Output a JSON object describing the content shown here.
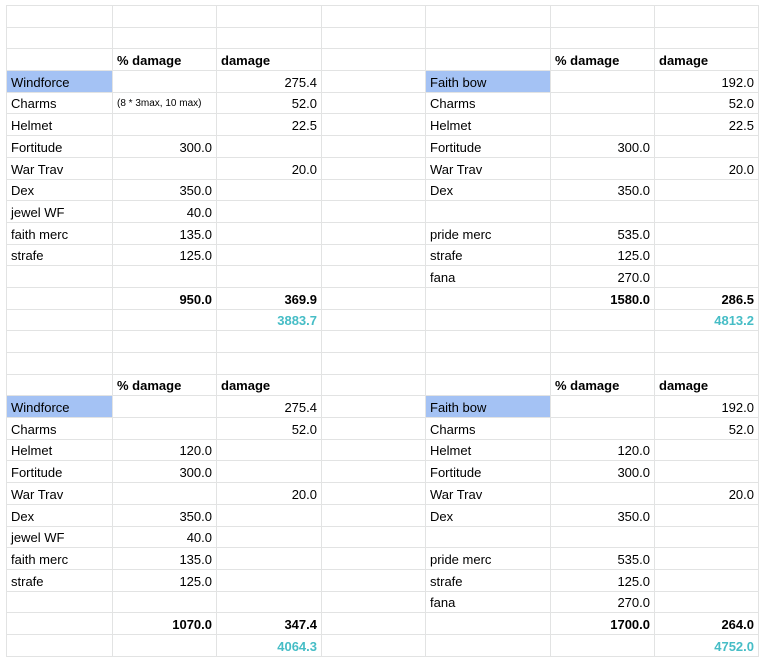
{
  "colors": {
    "highlight": "#a4c2f4",
    "total_text": "#46bdc6",
    "grid": "#e2e3e3"
  },
  "headers": {
    "pct": "% damage",
    "dmg": "damage"
  },
  "blocks": [
    {
      "rows": [
        {
          "label": "Windforce",
          "pct": "",
          "dmg": "275.4",
          "highlight": true
        },
        {
          "label": "Charms",
          "pct": "(8 * 3max, 10 max)",
          "dmg": "52.0",
          "note": true
        },
        {
          "label": "Helmet",
          "pct": "",
          "dmg": "22.5"
        },
        {
          "label": "Fortitude",
          "pct": "300.0",
          "dmg": ""
        },
        {
          "label": "War Trav",
          "pct": "",
          "dmg": "20.0"
        },
        {
          "label": "Dex",
          "pct": "350.0",
          "dmg": ""
        },
        {
          "label": "jewel WF",
          "pct": "40.0",
          "dmg": ""
        },
        {
          "label": "faith merc",
          "pct": "135.0",
          "dmg": ""
        },
        {
          "label": "strafe",
          "pct": "125.0",
          "dmg": ""
        },
        {
          "label": "",
          "pct": "",
          "dmg": ""
        }
      ],
      "sum_pct": "950.0",
      "sum_dmg": "369.9",
      "total": "3883.7"
    },
    {
      "rows": [
        {
          "label": "Faith bow",
          "pct": "",
          "dmg": "192.0",
          "highlight": true
        },
        {
          "label": "Charms",
          "pct": "",
          "dmg": "52.0"
        },
        {
          "label": "Helmet",
          "pct": "",
          "dmg": "22.5"
        },
        {
          "label": "Fortitude",
          "pct": "300.0",
          "dmg": ""
        },
        {
          "label": "War Trav",
          "pct": "",
          "dmg": "20.0"
        },
        {
          "label": "Dex",
          "pct": "350.0",
          "dmg": ""
        },
        {
          "label": "",
          "pct": "",
          "dmg": ""
        },
        {
          "label": "pride merc",
          "pct": "535.0",
          "dmg": ""
        },
        {
          "label": "strafe",
          "pct": "125.0",
          "dmg": ""
        },
        {
          "label": "fana",
          "pct": "270.0",
          "dmg": ""
        }
      ],
      "sum_pct": "1580.0",
      "sum_dmg": "286.5",
      "total": "4813.2"
    },
    {
      "rows": [
        {
          "label": "Windforce",
          "pct": "",
          "dmg": "275.4",
          "highlight": true
        },
        {
          "label": "Charms",
          "pct": "",
          "dmg": "52.0"
        },
        {
          "label": "Helmet",
          "pct": "120.0",
          "dmg": ""
        },
        {
          "label": "Fortitude",
          "pct": "300.0",
          "dmg": ""
        },
        {
          "label": "War Trav",
          "pct": "",
          "dmg": "20.0"
        },
        {
          "label": "Dex",
          "pct": "350.0",
          "dmg": ""
        },
        {
          "label": "jewel WF",
          "pct": "40.0",
          "dmg": ""
        },
        {
          "label": "faith merc",
          "pct": "135.0",
          "dmg": ""
        },
        {
          "label": "strafe",
          "pct": "125.0",
          "dmg": ""
        },
        {
          "label": "",
          "pct": "",
          "dmg": ""
        }
      ],
      "sum_pct": "1070.0",
      "sum_dmg": "347.4",
      "total": "4064.3"
    },
    {
      "rows": [
        {
          "label": "Faith bow",
          "pct": "",
          "dmg": "192.0",
          "highlight": true
        },
        {
          "label": "Charms",
          "pct": "",
          "dmg": "52.0"
        },
        {
          "label": "Helmet",
          "pct": "120.0",
          "dmg": ""
        },
        {
          "label": "Fortitude",
          "pct": "300.0",
          "dmg": ""
        },
        {
          "label": "War Trav",
          "pct": "",
          "dmg": "20.0"
        },
        {
          "label": "Dex",
          "pct": "350.0",
          "dmg": ""
        },
        {
          "label": "",
          "pct": "",
          "dmg": ""
        },
        {
          "label": "pride merc",
          "pct": "535.0",
          "dmg": ""
        },
        {
          "label": "strafe",
          "pct": "125.0",
          "dmg": ""
        },
        {
          "label": "fana",
          "pct": "270.0",
          "dmg": ""
        }
      ],
      "sum_pct": "1700.0",
      "sum_dmg": "264.0",
      "total": "4752.0"
    }
  ]
}
